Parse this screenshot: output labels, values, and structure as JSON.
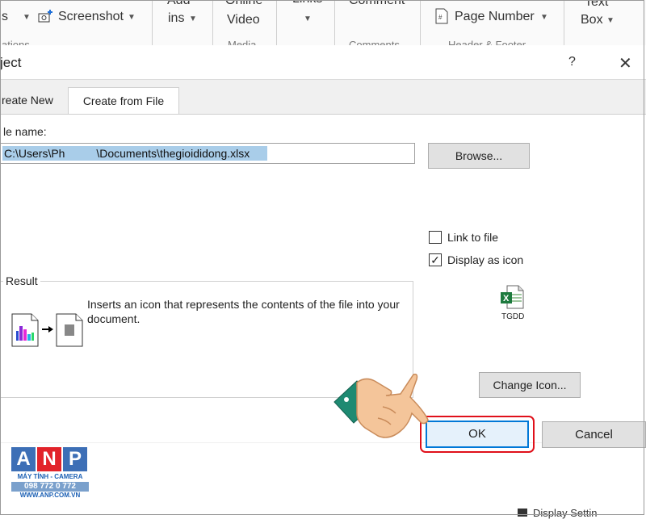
{
  "ribbon": {
    "s_label": "s",
    "screenshot_label": "Screenshot",
    "addins_line1": "Add",
    "addins_line2": "ins",
    "online_video_line1": "Online",
    "online_video_line2": "Video",
    "media_group": "Media",
    "links_label": "Links",
    "comment_label": "Comment",
    "comments_group": "Comments",
    "page_number_label": "Page Number",
    "header_footer_group": "Header & Footer",
    "text_box_line1": "Text",
    "text_box_line2": "Box",
    "options_group": "ations"
  },
  "dialog": {
    "title": "ject",
    "help": "?",
    "close": "✕",
    "tabs": [
      {
        "label": "reate New"
      },
      {
        "label": "Create from File"
      }
    ],
    "file_name_label": "le name:",
    "file_name_value": "C:\\Users\\Ph          \\Documents\\thegioididong.xlsx",
    "browse_label": "Browse...",
    "link_to_file_label": "Link to file",
    "link_to_file_checked": false,
    "display_as_icon_label": "Display as icon",
    "display_as_icon_checked": true,
    "icon_caption": "TGDD",
    "result_label": "Result",
    "result_text": "Inserts an icon that represents the contents of the file into your document.",
    "change_icon_label": "Change Icon...",
    "ok_label": "OK",
    "cancel_label": "Cancel"
  },
  "status": {
    "display_settings": "Display Settin"
  },
  "watermark": {
    "letters": [
      "A",
      "N",
      "P"
    ],
    "tagline": "MÁY TÍNH - CAMERA",
    "phone": "098 772 0 772",
    "url": "WWW.ANP.COM.VN",
    "letter_colors": [
      "#3d6fb6",
      "#e2232a",
      "#3d6fb6"
    ]
  },
  "colors": {
    "ok_highlight_ring": "#e0101a",
    "focus_border": "#0078d7",
    "selection": "#a9cde9"
  }
}
